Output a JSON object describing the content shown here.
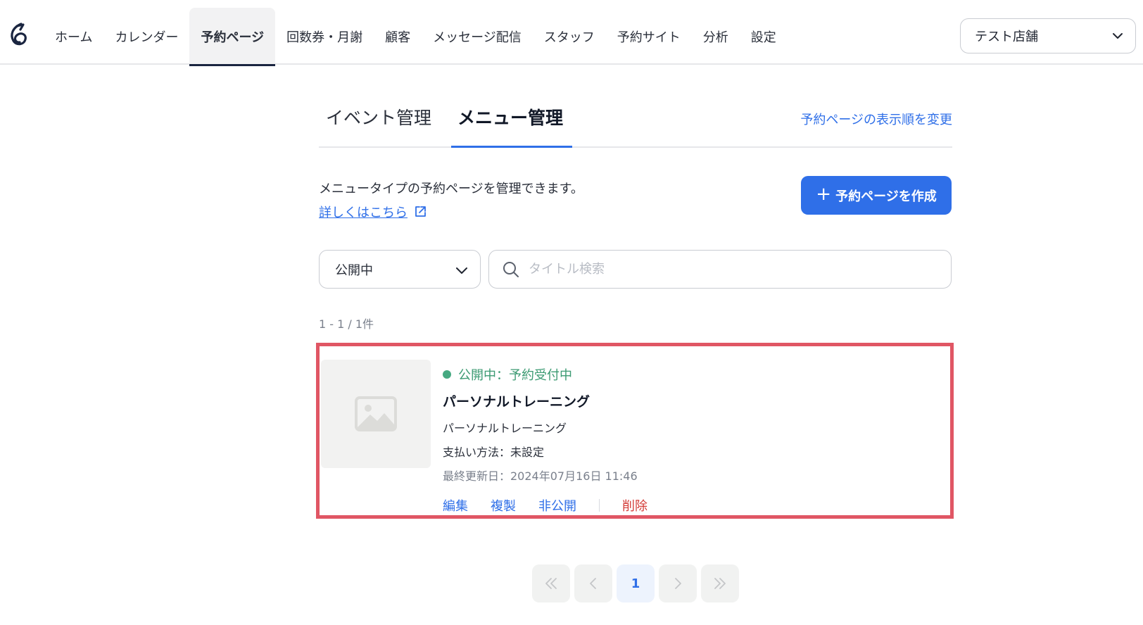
{
  "nav": {
    "items": [
      {
        "label": "ホーム",
        "active": false
      },
      {
        "label": "カレンダー",
        "active": false
      },
      {
        "label": "予約ページ",
        "active": true
      },
      {
        "label": "回数券・月謝",
        "active": false
      },
      {
        "label": "顧客",
        "active": false
      },
      {
        "label": "メッセージ配信",
        "active": false
      },
      {
        "label": "スタッフ",
        "active": false
      },
      {
        "label": "予約サイト",
        "active": false
      },
      {
        "label": "分析",
        "active": false
      },
      {
        "label": "設定",
        "active": false
      }
    ],
    "store": "テスト店舗"
  },
  "tabs": [
    {
      "label": "イベント管理",
      "active": false
    },
    {
      "label": "メニュー管理",
      "active": true
    }
  ],
  "reorder_link": "予約ページの表示順を変更",
  "description": "メニュータイプの予約ページを管理できます。",
  "detail_link": "詳しくはこちら",
  "create_button": "予約ページを作成",
  "filter": {
    "status_value": "公開中",
    "search_placeholder": "タイトル検索"
  },
  "count_text": "1 - 1 / 1件",
  "card": {
    "status": "公開中：予約受付中",
    "title": "パーソナルトレーニング",
    "subtitle": "パーソナルトレーニング",
    "payment": "支払い方法：未設定",
    "updated": "最終更新日：2024年07月16日 11:46",
    "actions": {
      "edit": "編集",
      "copy": "複製",
      "unpublish": "非公開",
      "delete": "削除"
    }
  },
  "pagination": {
    "current": "1"
  },
  "colors": {
    "accent": "#2f6fe8",
    "status_green": "#46a981",
    "danger": "#d33a36",
    "highlight": "#e05664"
  }
}
